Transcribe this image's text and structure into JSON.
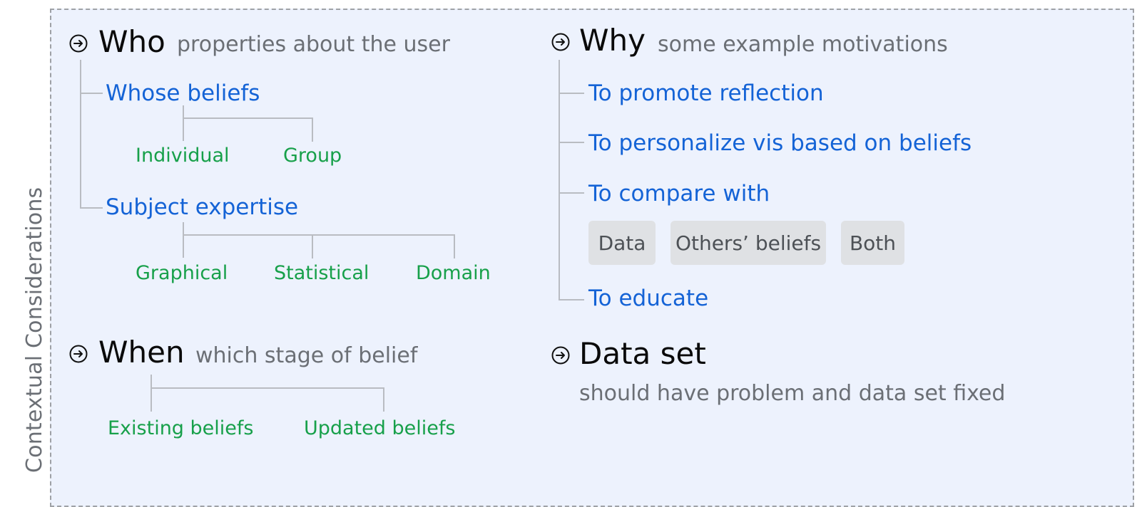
{
  "side_label": "Contextual Considerations",
  "who": {
    "title": "Who",
    "subtitle": "properties about the user",
    "icon": "arrow-circle-icon",
    "groups": [
      {
        "label": "Whose beliefs",
        "children": [
          "Individual",
          "Group"
        ]
      },
      {
        "label": "Subject expertise",
        "children": [
          "Graphical",
          "Statistical",
          "Domain"
        ]
      }
    ]
  },
  "why": {
    "title": "Why",
    "subtitle": "some example motivations",
    "icon": "arrow-circle-icon",
    "items": [
      "To promote reflection",
      "To personalize vis based on beliefs",
      "To compare with",
      "To educate"
    ],
    "compare_options": [
      "Data",
      "Others’ beliefs",
      "Both"
    ]
  },
  "when": {
    "title": "When",
    "subtitle": "which stage of belief",
    "icon": "arrow-circle-icon",
    "children": [
      "Existing beliefs",
      "Updated beliefs"
    ]
  },
  "data_set": {
    "title": "Data set",
    "subtitle": "should have problem and data set fixed",
    "icon": "arrow-circle-icon"
  },
  "colors": {
    "panel_background": "#edf2fd",
    "heading": "#0a0a0a",
    "subtitle": "#6b6f75",
    "level1": "#1463d6",
    "level2": "#17a04a",
    "chip_background": "#dfe1e4"
  }
}
